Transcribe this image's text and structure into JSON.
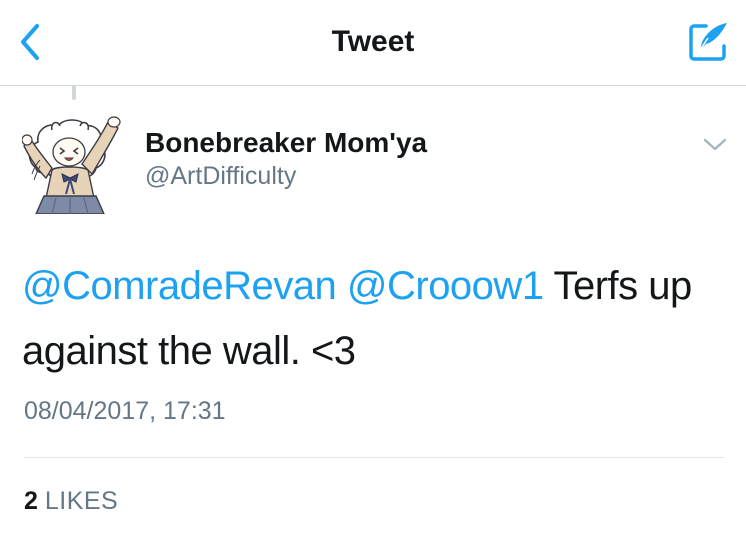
{
  "colors": {
    "accent": "#1da1f2",
    "text_primary": "#14171a",
    "text_secondary": "#657786",
    "divider": "#e1e8ed"
  },
  "nav": {
    "title": "Tweet",
    "back_icon": "chevron-left-icon",
    "compose_icon": "compose-quill-icon"
  },
  "tweet": {
    "author": {
      "display_name": "Bonebreaker Mom'ya",
      "handle": "@ArtDifficulty",
      "avatar_icon": "avatar-drawing"
    },
    "more_icon": "chevron-down-icon",
    "mentions": [
      "@ComradeRevan",
      "@Crooow1"
    ],
    "body_text": "Terfs up against the wall. <3",
    "timestamp": "08/04/2017, 17:31",
    "likes_count": "2",
    "likes_label": "LIKES"
  }
}
